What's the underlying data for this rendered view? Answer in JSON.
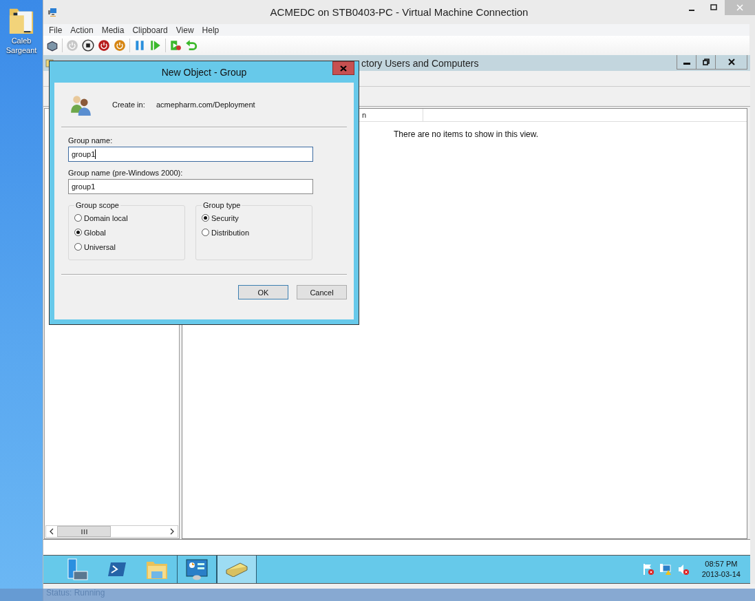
{
  "desktop": {
    "icon_label": "Caleb Sargeant"
  },
  "window": {
    "title": "ACMEDC on STB0403-PC - Virtual Machine Connection"
  },
  "menu": [
    "File",
    "Action",
    "Media",
    "Clipboard",
    "View",
    "Help"
  ],
  "guest": {
    "app_title": "ctory Users and Computers",
    "column_header": "n",
    "empty_message": "There are no items to show in this view.",
    "taskbar": [
      {
        "kind": "server",
        "running": false,
        "selected": false
      },
      {
        "kind": "shell",
        "running": false,
        "selected": false
      },
      {
        "kind": "explorer",
        "running": false,
        "selected": false
      },
      {
        "kind": "control",
        "running": true,
        "selected": false
      },
      {
        "kind": "directory",
        "running": true,
        "selected": true
      }
    ],
    "clock": {
      "time": "08:57 PM",
      "date": "2013-03-14"
    }
  },
  "dialog": {
    "title": "New Object - Group",
    "create_in_label": "Create in:",
    "create_in_path": "acmepharm.com/Deployment",
    "fields": [
      {
        "label": "Group name:",
        "value": "group1",
        "focused": true
      },
      {
        "label": "Group name (pre-Windows 2000):",
        "value": "group1",
        "focused": false
      }
    ],
    "groups": [
      {
        "title": "Group scope",
        "options": [
          {
            "label": "Domain local",
            "selected": false
          },
          {
            "label": "Global",
            "selected": true
          },
          {
            "label": "Universal",
            "selected": false
          }
        ]
      },
      {
        "title": "Group type",
        "options": [
          {
            "label": "Security",
            "selected": true
          },
          {
            "label": "Distribution",
            "selected": false
          }
        ]
      }
    ],
    "buttons": [
      {
        "label": "OK",
        "default": true
      },
      {
        "label": "Cancel",
        "default": false
      }
    ]
  },
  "status_bar": {
    "text": "Status: Running"
  }
}
